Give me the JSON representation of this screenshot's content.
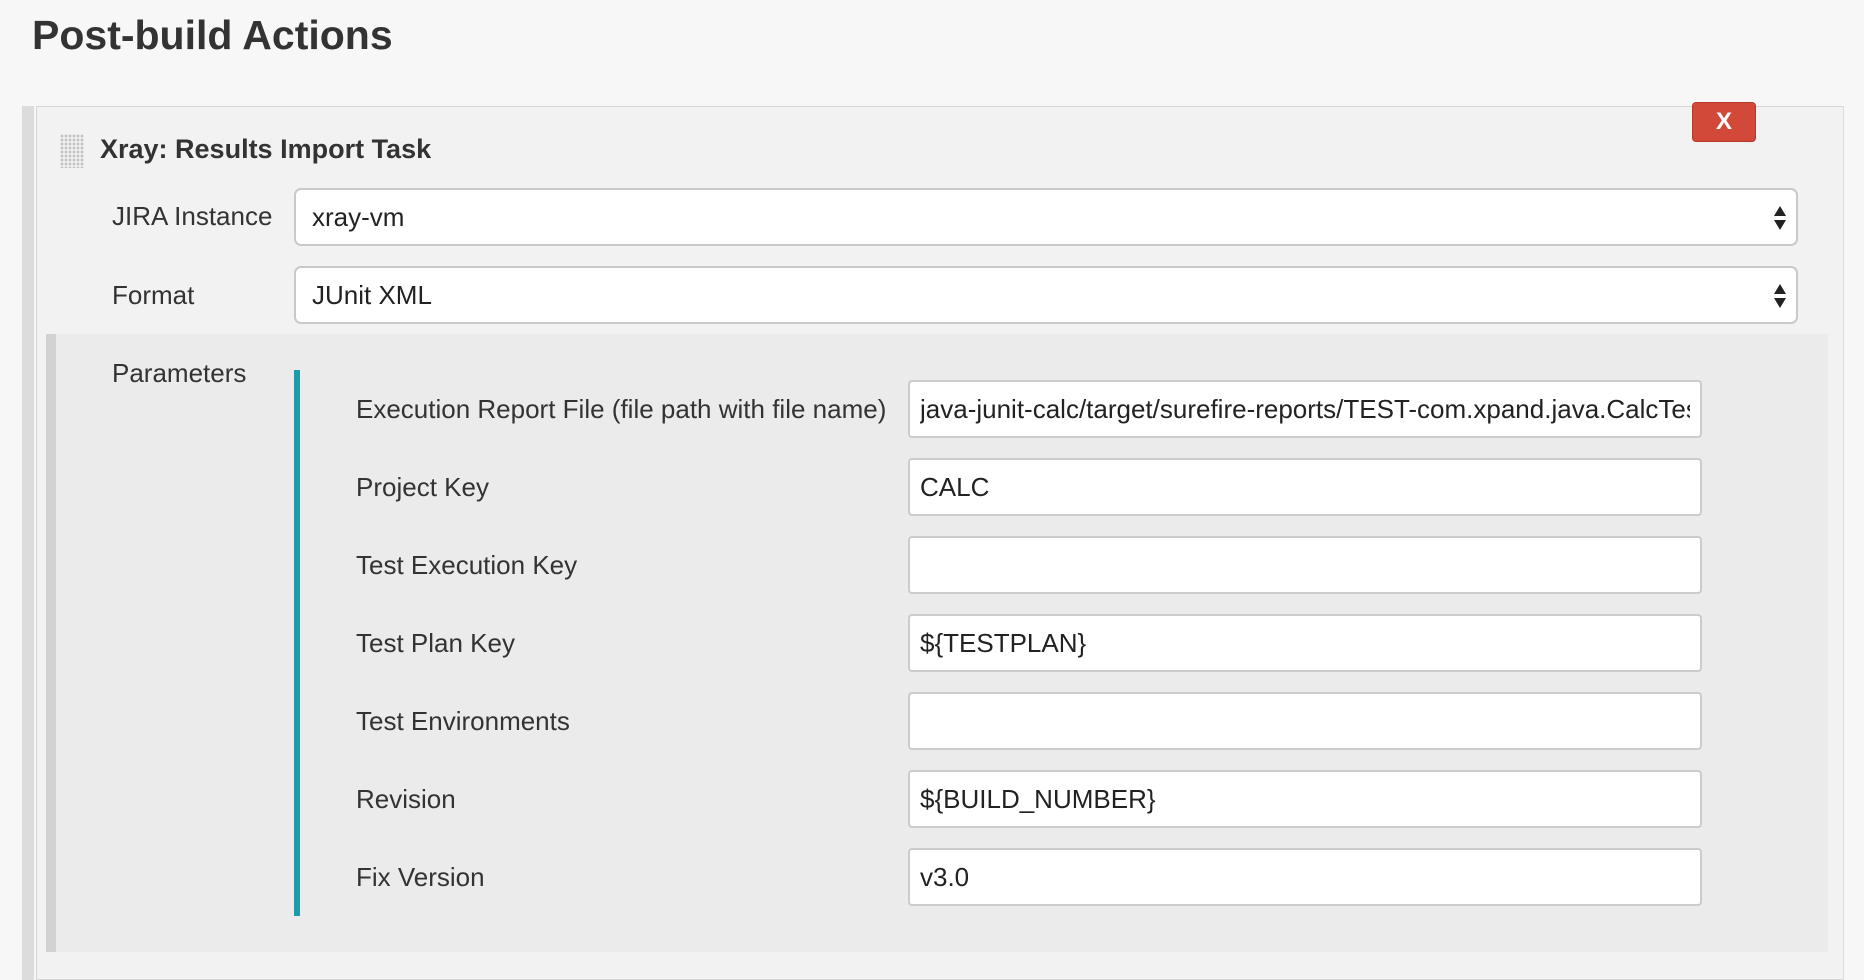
{
  "section": {
    "title": "Post-build Actions"
  },
  "task": {
    "title": "Xray: Results Import Task",
    "close_label": "X"
  },
  "jira_instance": {
    "label": "JIRA Instance",
    "value": "xray-vm"
  },
  "format": {
    "label": "Format",
    "value": "JUnit XML"
  },
  "parameters": {
    "label": "Parameters",
    "fields": [
      {
        "label": "Execution Report File (file path with file name)",
        "value": "java-junit-calc/target/surefire-reports/TEST-com.xpand.java.CalcTest.xml"
      },
      {
        "label": "Project Key",
        "value": "CALC"
      },
      {
        "label": "Test Execution Key",
        "value": ""
      },
      {
        "label": "Test Plan Key",
        "value": "${TESTPLAN}"
      },
      {
        "label": "Test Environments",
        "value": ""
      },
      {
        "label": "Revision",
        "value": "${BUILD_NUMBER}"
      },
      {
        "label": "Fix Version",
        "value": "v3.0"
      }
    ]
  },
  "colors": {
    "close_button": "#d24939",
    "accent_bar": "#1e9ba8"
  },
  "icons": {
    "drag_handle": "grip-icon",
    "select_arrows": "sort-arrows-icon"
  }
}
